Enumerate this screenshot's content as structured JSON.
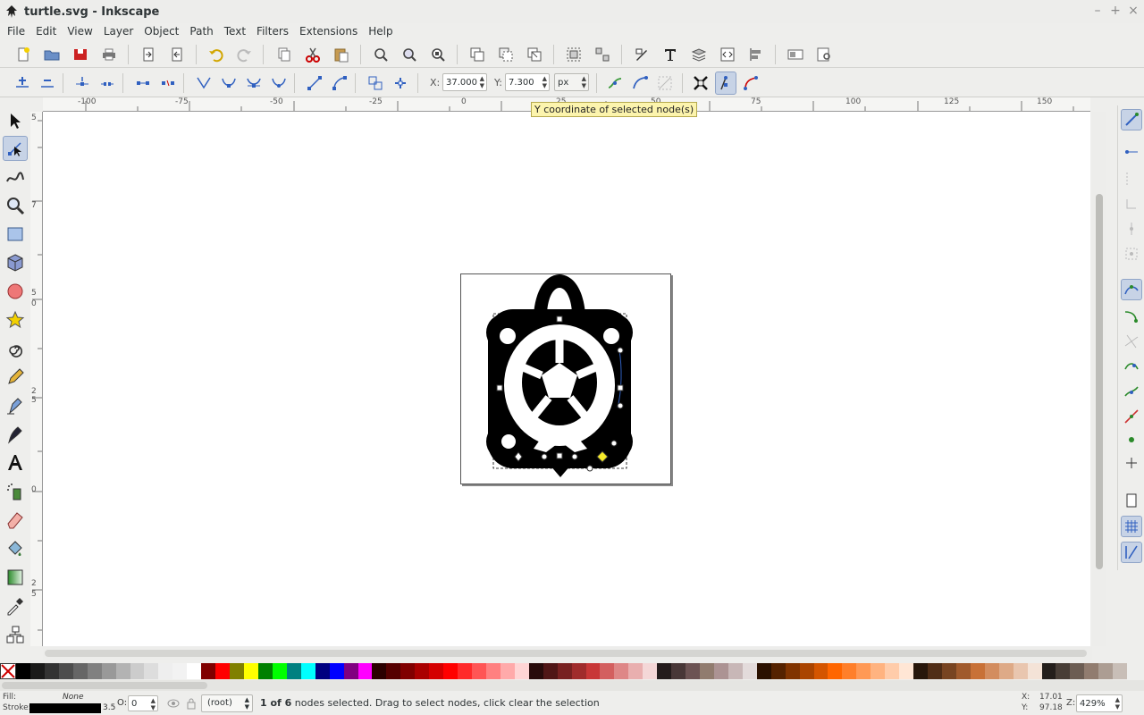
{
  "window": {
    "title": "turtle.svg - Inkscape",
    "min": "–",
    "max": "+",
    "close": "×"
  },
  "menu": [
    "File",
    "Edit",
    "View",
    "Layer",
    "Object",
    "Path",
    "Text",
    "Filters",
    "Extensions",
    "Help"
  ],
  "node_toolbar": {
    "x_label": "X:",
    "x_value": "37.000",
    "y_label": "Y:",
    "y_value": "7.300",
    "unit": "px"
  },
  "tooltip": "Y coordinate of selected node(s)",
  "hruler_ticks": [
    "-100",
    "-75",
    "-50",
    "-25",
    "0",
    "25",
    "50",
    "75",
    "100",
    "125",
    "150"
  ],
  "vruler_ticks": [
    "5",
    "7",
    "5",
    "0",
    "2",
    "5",
    "0",
    "2",
    "5"
  ],
  "status": {
    "fill_label": "Fill:",
    "fill_value": "None",
    "stroke_label": "Stroke:",
    "stroke_width": "3.5",
    "opacity_label": "O:",
    "opacity_value": "0",
    "layer": "(root)",
    "message_bold": "1 of 6",
    "message_rest": " nodes selected. Drag to select nodes, click clear the selection",
    "cursor_x_label": "X:",
    "cursor_x": "17.01",
    "cursor_y_label": "Y:",
    "cursor_y": "97.18",
    "zoom_label": "Z:",
    "zoom_value": "429%"
  },
  "palette": [
    "#000000",
    "#1a1a1a",
    "#333333",
    "#4d4d4d",
    "#666666",
    "#808080",
    "#999999",
    "#b3b3b3",
    "#cccccc",
    "#dddddd",
    "#eeeeee",
    "#f2f2f2",
    "#ffffff",
    "#800000",
    "#ff0000",
    "#808000",
    "#ffff00",
    "#008000",
    "#00ff00",
    "#008080",
    "#00ffff",
    "#000080",
    "#0000ff",
    "#800080",
    "#ff00ff",
    "#2b0000",
    "#550000",
    "#800000",
    "#aa0000",
    "#d40000",
    "#ff0000",
    "#ff2a2a",
    "#ff5555",
    "#ff8080",
    "#ffaaaa",
    "#ffd5d5",
    "#280b0b",
    "#501616",
    "#782121",
    "#a02c2c",
    "#c83737",
    "#d35f5f",
    "#de8787",
    "#e9afaf",
    "#f4d7d7",
    "#241c1c",
    "#483737",
    "#6c5353",
    "#917c6f",
    "#ac9393",
    "#c8b7b7",
    "#e3dbdb",
    "#2b1100",
    "#552200",
    "#803300",
    "#aa4400",
    "#d45500",
    "#ff6600",
    "#ff7f2a",
    "#ff9955",
    "#ffb380",
    "#ffccaa",
    "#ffe6d5",
    "#28170b",
    "#502d16",
    "#784421",
    "#a05a2c",
    "#c87137",
    "#d38d5f",
    "#deaa87",
    "#e9c6af",
    "#f4e3d7",
    "#241f1c",
    "#483e37",
    "#6c5d53",
    "#917c6f",
    "#ac9d93",
    "#c8beb7"
  ]
}
